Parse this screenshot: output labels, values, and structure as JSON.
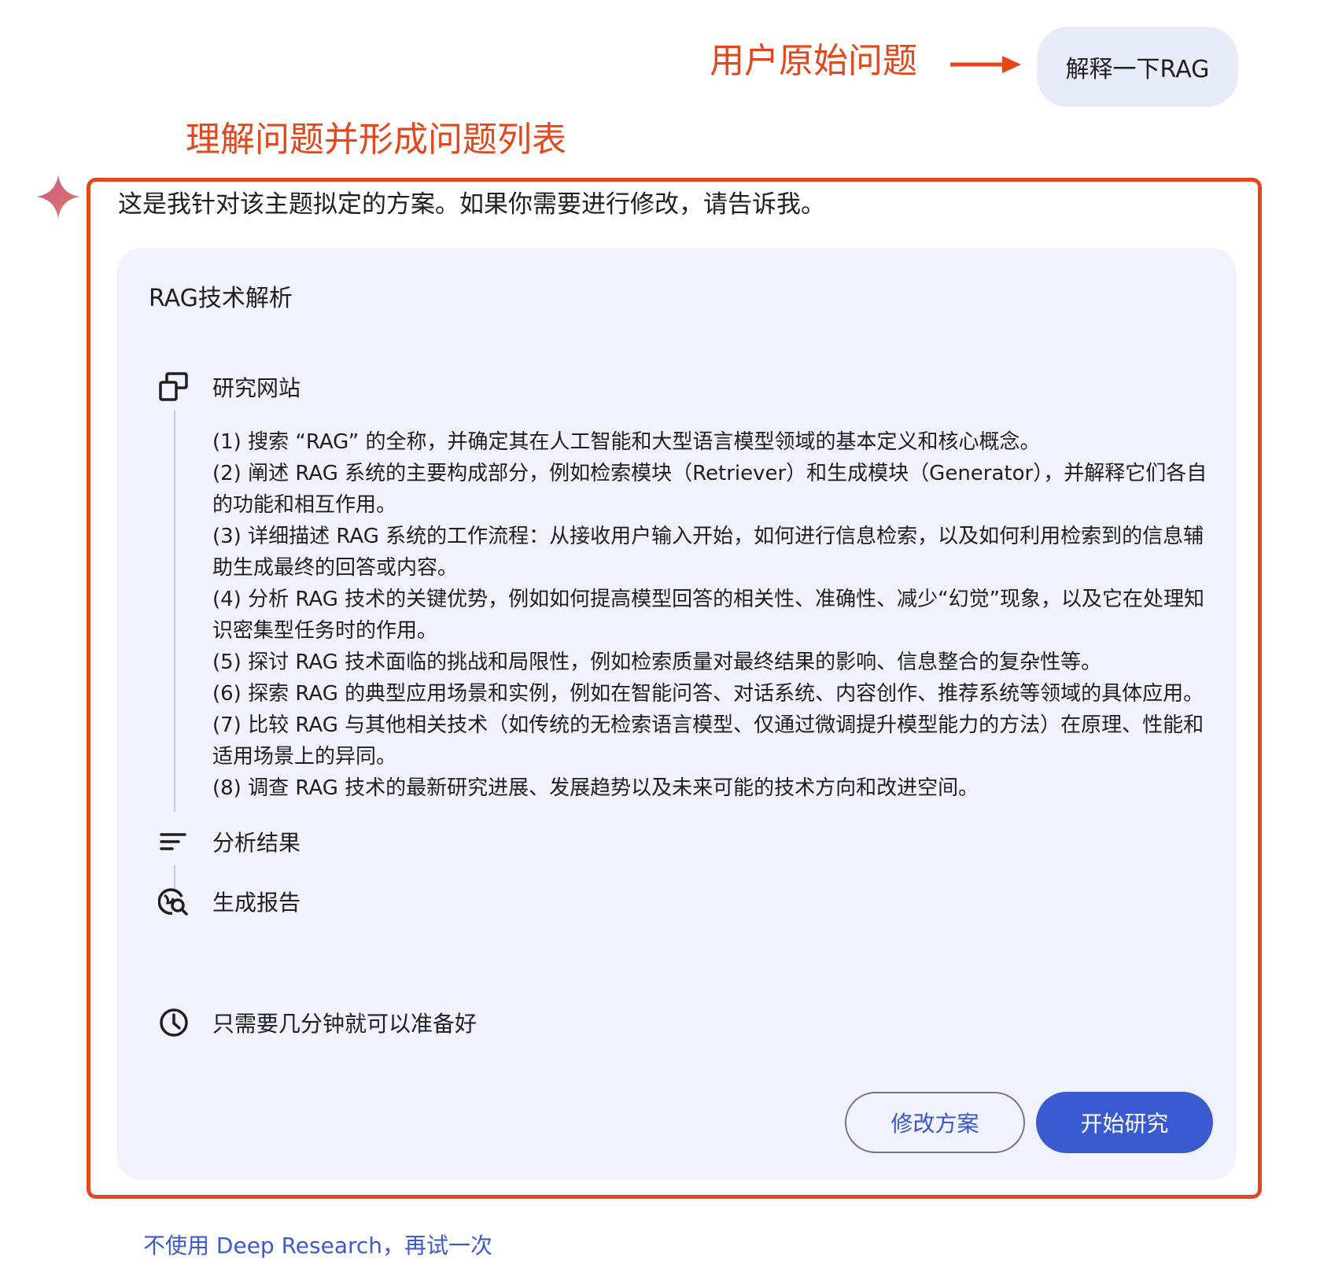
{
  "annotations": {
    "user_question": "用户原始问题",
    "understand": "理解问题并形成问题列表"
  },
  "user_message": "解释一下RAG",
  "intro_text": "这是我针对该主题拟定的方案。如果你需要进行修改，请告诉我。",
  "plan": {
    "title": "RAG技术解析",
    "steps": [
      {
        "icon": "research-websites-icon",
        "label": "研究网站"
      },
      {
        "icon": "analyze-results-icon",
        "label": "分析结果"
      },
      {
        "icon": "generate-report-icon",
        "label": "生成报告"
      }
    ],
    "items": [
      "(1) 搜索 “RAG” 的全称，并确定其在人工智能和大型语言模型领域的基本定义和核心概念。",
      "(2) 阐述 RAG 系统的主要构成部分，例如检索模块（Retriever）和生成模块（Generator），并解释它们各自的功能和相互作用。",
      "(3) 详细描述 RAG 系统的工作流程：从接收用户输入开始，如何进行信息检索，以及如何利用检索到的信息辅助生成最终的回答或内容。",
      "(4) 分析 RAG 技术的关键优势，例如如何提高模型回答的相关性、准确性、减少“幻觉”现象，以及它在处理知识密集型任务时的作用。",
      "(5) 探讨 RAG 技术面临的挑战和局限性，例如检索质量对最终结果的影响、信息整合的复杂性等。",
      "(6) 探索 RAG 的典型应用场景和实例，例如在智能问答、对话系统、内容创作、推荐系统等领域的具体应用。",
      "(7) 比较 RAG 与其他相关技术（如传统的无检索语言模型、仅通过微调提升模型能力的方法）在原理、性能和适用场景上的异同。",
      "(8) 调查 RAG 技术的最新研究进展、发展趋势以及未来可能的技术方向和改进空间。"
    ],
    "time_note": "只需要几分钟就可以准备好",
    "time_icon": "clock-icon"
  },
  "buttons": {
    "edit": "修改方案",
    "start": "开始研究"
  },
  "retry_link": "不使用 Deep Research，再试一次",
  "colors": {
    "annotation": "#e4471c",
    "accent": "#3a5ad0",
    "card_bg": "#f0f2fd",
    "bubble_bg": "#e8ebf8"
  }
}
